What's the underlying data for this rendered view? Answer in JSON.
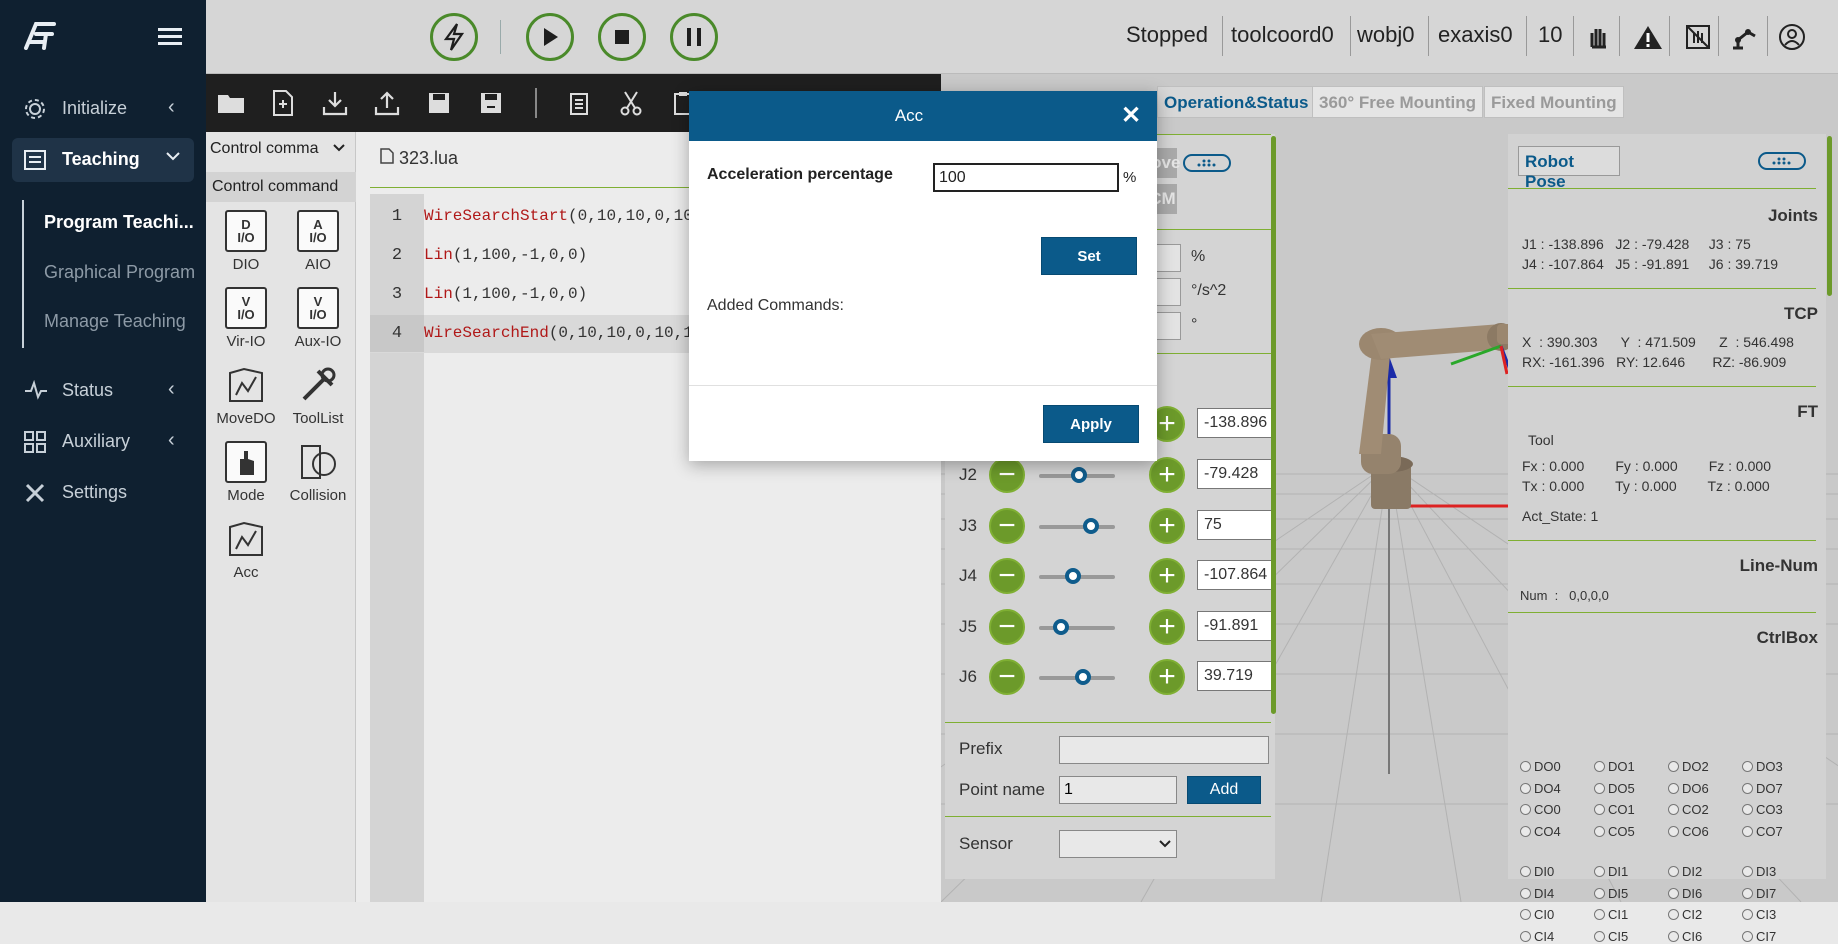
{
  "sidebar": {
    "logo_icon": "fairino-logo",
    "items": [
      {
        "label": "Initialize",
        "icon": "gear-icon"
      },
      {
        "label": "Teaching",
        "icon": "list-icon"
      },
      {
        "label": "Status",
        "icon": "pulse-icon"
      },
      {
        "label": "Auxiliary",
        "icon": "grid-icon"
      },
      {
        "label": "Settings",
        "icon": "tools-icon"
      }
    ],
    "sub_items": [
      "Program Teachi...",
      "Graphical Program",
      "Manage Teaching"
    ]
  },
  "topbar": {
    "status": "Stopped",
    "tool": "toolcoord0",
    "wobj": "wobj0",
    "exaxis": "exaxis0",
    "speed": "10"
  },
  "command_panel": {
    "dropdown": "Control comma",
    "header": "Control command",
    "commands": [
      {
        "label": "DIO",
        "glyph_top": "D",
        "glyph_bottom": "I/O"
      },
      {
        "label": "AIO",
        "glyph_top": "A",
        "glyph_bottom": "I/O"
      },
      {
        "label": "Vir-IO",
        "glyph_top": "V",
        "glyph_bottom": "I/O"
      },
      {
        "label": "Aux-IO",
        "glyph_top": "V",
        "glyph_bottom": "I/O"
      },
      {
        "label": "MoveDO"
      },
      {
        "label": "ToolList"
      },
      {
        "label": "Mode"
      },
      {
        "label": "Collision"
      },
      {
        "label": "Acc"
      }
    ]
  },
  "editor": {
    "filename": "323.lua",
    "lines": [
      {
        "num": "1",
        "fn": "WireSearchStart",
        "args": "(0,10,10,0,10,"
      },
      {
        "num": "2",
        "fn": "Lin",
        "args": "(1,100,-1,0,0)"
      },
      {
        "num": "3",
        "fn": "Lin",
        "args": "(1,100,-1,0,0)"
      },
      {
        "num": "4",
        "fn": "WireSearchEnd",
        "args": "(0,10,10,0,10,10"
      }
    ]
  },
  "tabs": [
    "Operation&Status",
    "360° Free Mounting",
    "Fixed Mounting"
  ],
  "jog": {
    "move_label": "Move",
    "rcm_label": "RCM",
    "units": [
      "%",
      "°/s^2",
      "°"
    ],
    "joints": [
      {
        "label": "J2",
        "value": "-79.428"
      },
      {
        "label": "J3",
        "value": "75"
      },
      {
        "label": "J4",
        "value": "-107.864"
      },
      {
        "label": "J5",
        "value": "-91.891"
      },
      {
        "label": "J6",
        "value": "39.719"
      }
    ],
    "j1_value": "-138.896",
    "prefix_label": "Prefix",
    "prefix_value": "",
    "point_name_label": "Point name",
    "point_name_value": "1",
    "add_label": "Add",
    "sensor_label": "Sensor",
    "sensor_value": ""
  },
  "robot_pose": {
    "button": "Robot Pose",
    "joints_title": "Joints",
    "joints_row1": "J1 : -138.896   J2 : -79.428     J3 : 75",
    "joints_row2": "J4 : -107.864   J5 : -91.891     J6 : 39.719",
    "tcp_title": "TCP",
    "tcp_row1": "X  : 390.303      Y  : 471.509      Z  : 546.498",
    "tcp_row2": "RX: -161.396   RY: 12.646       RZ: -86.909",
    "ft_title": "FT",
    "ft_tool": "Tool",
    "ft_row1": "Fx : 0.000        Fy : 0.000        Fz : 0.000",
    "ft_row2": "Tx : 0.000        Ty : 0.000        Tz : 0.000",
    "act_state": "Act_State: 1",
    "linenum_title": "Line-Num",
    "num_text": "Num  :   0,0,0,0",
    "ctrlbox_title": "CtrlBox",
    "do_labels": [
      "DO0",
      "DO1",
      "DO2",
      "DO3",
      "DO4",
      "DO5",
      "DO6",
      "DO7",
      "CO0",
      "CO1",
      "CO2",
      "CO3",
      "CO4",
      "CO5",
      "CO6",
      "CO7"
    ],
    "di_labels": [
      "DI0",
      "DI1",
      "DI2",
      "DI3",
      "DI4",
      "DI5",
      "DI6",
      "DI7",
      "CI0",
      "CI1",
      "CI2",
      "CI3",
      "CI4",
      "CI5",
      "CI6",
      "CI7"
    ]
  },
  "dialog": {
    "title": "Acc",
    "close": "✕",
    "field_label": "Acceleration percentage",
    "field_value": "100",
    "unit": "%",
    "set_label": "Set",
    "added_label": "Added Commands:",
    "apply_label": "Apply"
  }
}
